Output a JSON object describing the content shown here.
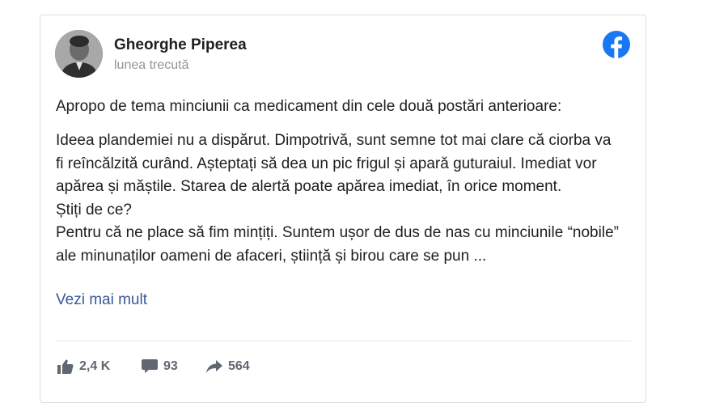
{
  "post": {
    "author": "Gheorghe Piperea",
    "timestamp": "lunea trecută",
    "paragraph1": "Apropo de tema minciunii ca medicament din cele două postări anterioare:",
    "paragraph2": "Ideea plandemiei nu a dispărut. Dimpotrivă, sunt semne tot mai clare că ciorba va fi reîncălzită curând. Așteptați să dea un pic frigul și apară guturaiul. Imediat vor apărea și măștile. Starea de alertă poate apărea imediat, în orice moment.",
    "paragraph3": "Știți de ce?",
    "paragraph4": "Pentru că ne place să fim mințiți. Suntem ușor de dus de nas cu minciunile “nobile” ale minunaților oameni de afaceri, știință și birou care se pun ...",
    "see_more": "Vezi mai mult"
  },
  "stats": {
    "likes": "2,4 K",
    "comments": "93",
    "shares": "564"
  },
  "icons": {
    "brand": "facebook-logo-icon",
    "like": "thumbs-up-icon",
    "comment": "comment-bubble-icon",
    "share": "share-arrow-icon"
  },
  "colors": {
    "facebook_blue": "#1877f2",
    "link": "#385898",
    "text": "#1c1e21",
    "muted": "#606770"
  }
}
